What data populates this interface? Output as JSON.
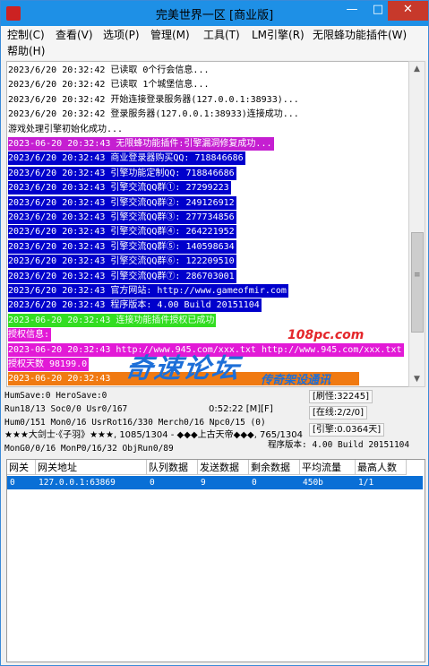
{
  "window": {
    "title": "完美世界一区 [商业版]",
    "minimize_glyph": "—",
    "maximize_glyph": "□",
    "close_glyph": "✕"
  },
  "menu": [
    {
      "label": "控制(C)"
    },
    {
      "label": "查看(V)"
    },
    {
      "label": "选项(P)"
    },
    {
      "label": "管理(M)"
    },
    {
      "label": "工具(T)"
    },
    {
      "label": "LM引擎(R)"
    },
    {
      "label": "无限蜂功能插件(W)"
    },
    {
      "label": "帮助(H)"
    }
  ],
  "log": [
    {
      "text": "2023/6/20 20:32:42 已读取 0个行会信息...",
      "color": "#000000",
      "bg": ""
    },
    {
      "text": "2023/6/20 20:32:42 已读取 1个城堡信息...",
      "color": "#000000",
      "bg": ""
    },
    {
      "text": "2023/6/20 20:32:42 开始连接登录服务器(127.0.0.1:38933)...",
      "color": "#000000",
      "bg": ""
    },
    {
      "text": "2023/6/20 20:32:42 登录服务器(127.0.0.1:38933)连接成功...",
      "color": "#000000",
      "bg": ""
    },
    {
      "text": "游戏处理引擎初始化成功...",
      "color": "#000000",
      "bg": ""
    },
    {
      "text": "2023-06-20 20:32:43 无限蜂功能插件:引擎漏洞修复成功...",
      "color": "#ffffff",
      "bg": "#c51fd1"
    },
    {
      "text": "2023/6/20 20:32:43 商业登录器购买QQ: 718846686",
      "color": "#ffffff",
      "bg": "#0000cc"
    },
    {
      "text": "2023/6/20 20:32:43 引擎功能定制QQ: 718846686",
      "color": "#ffffff",
      "bg": "#0000cc"
    },
    {
      "text": "2023/6/20 20:32:43 引擎交流QQ群①: 27299223",
      "color": "#ffffff",
      "bg": "#0000cc"
    },
    {
      "text": "2023/6/20 20:32:43 引擎交流QQ群②: 249126912",
      "color": "#ffffff",
      "bg": "#0000cc"
    },
    {
      "text": "2023/6/20 20:32:43 引擎交流QQ群③: 277734856",
      "color": "#ffffff",
      "bg": "#0000cc"
    },
    {
      "text": "2023/6/20 20:32:43 引擎交流QQ群④: 264221952",
      "color": "#ffffff",
      "bg": "#0000cc"
    },
    {
      "text": "2023/6/20 20:32:43 引擎交流QQ群⑤: 140598634",
      "color": "#ffffff",
      "bg": "#0000cc"
    },
    {
      "text": "2023/6/20 20:32:43 引擎交流QQ群⑥: 122209510",
      "color": "#ffffff",
      "bg": "#0000cc"
    },
    {
      "text": "2023/6/20 20:32:43 引擎交流QQ群⑦: 286703001",
      "color": "#ffffff",
      "bg": "#0000cc"
    },
    {
      "text": "2023/6/20 20:32:43 官方网站: http://www.gameofmir.com",
      "color": "#ffffff",
      "bg": "#0000cc"
    },
    {
      "text": "2023/6/20 20:32:43 程序版本: 4.00 Build 20151104",
      "color": "#ffffff",
      "bg": "#0000cc"
    },
    {
      "text": "2023-06-20 20:32:43 连接功能插件授权已成功",
      "color": "#e8ffe8",
      "bg": "#33dd22"
    },
    {
      "text": "授权信息:",
      "color": "#ffffff",
      "bg": "#e21ad6"
    },
    {
      "text": "2023-06-20 20:32:43 http://www.945.com/xxx.txt http://www.945.com/xxx.txt",
      "color": "#ffffff",
      "bg": "#e21ad6"
    },
    {
      "text": "授权天数 98199.0",
      "color": "#ffffff",
      "bg": "#e21ad6"
    },
    {
      "text": "2023-06-20 20:32:43",
      "color": "#ffffff",
      "bg": "#f07a12"
    },
    {
      "text": "",
      "color": "#ffffff",
      "bg": "#f07a12"
    }
  ],
  "watermark": {
    "main": "奇速论坛",
    "sub": "传奇架设通讯",
    "url": "108pc.com"
  },
  "status": {
    "line1_left": "HumSave:0 HeroSave:0",
    "refresh_monster": "[刷怪:32245]",
    "line2_left": "Run18/13 Soc0/0 Usr0/167",
    "time_flags": "0:52:22 [M][F]",
    "online": "[在线:2/2/0]",
    "line3_left": "Hum0/151 Mon0/16 UsrRot16/330 Merch0/16 Npc0/15 (0)",
    "engine": "[引擎:0.0364天]",
    "line4_left": "★★★大剑士·《子羽》★★★, 1085/1304 - ◆◆◆上古天帝◆◆◆, 765/1304",
    "line5_left": "MonG0/0/16 MonP0/16/32 ObjRun0/89",
    "version": "程序版本: 4.00 Build 20151104"
  },
  "table": {
    "headers": [
      "网关",
      "网关地址",
      "队列数据",
      "发送数据",
      "剩余数据",
      "平均流量",
      "最高人数"
    ],
    "rows": [
      [
        "0",
        "127.0.0.1:63869",
        "0",
        "9",
        "0",
        "450b",
        "1/1"
      ]
    ]
  }
}
